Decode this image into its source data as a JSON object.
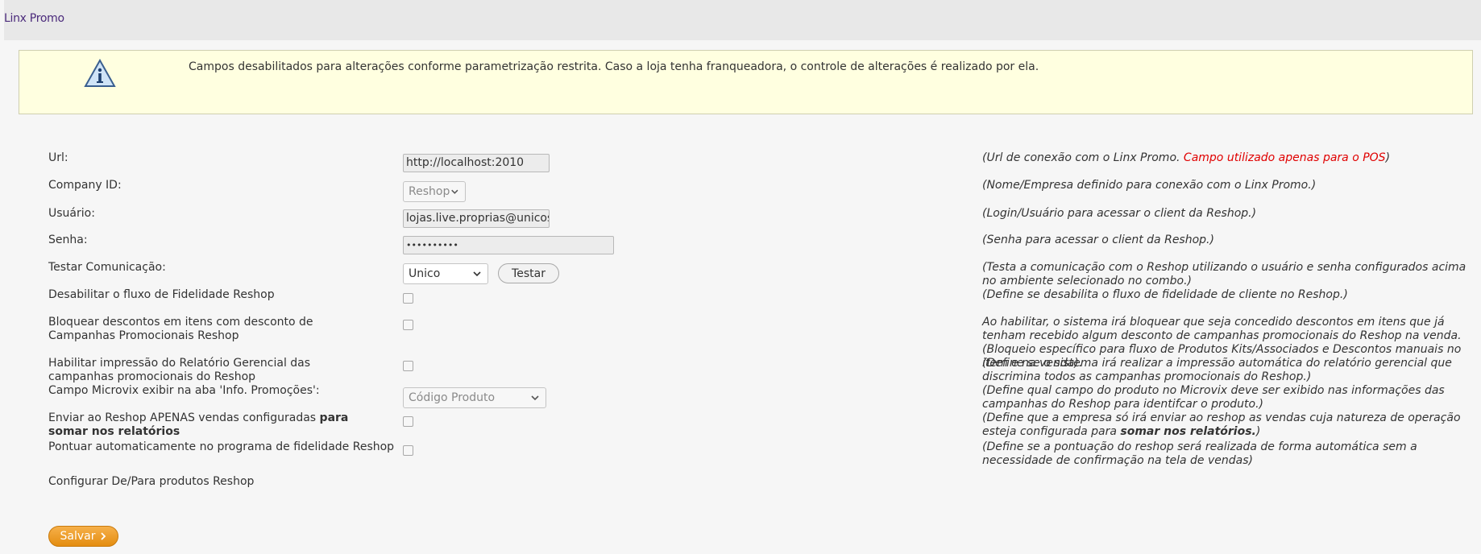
{
  "app": {
    "title": "Linx Promo"
  },
  "alert": {
    "icon": "info-icon",
    "message": "Campos desabilitados para alterações conforme parametrização restrita. Caso a loja tenha franqueadora, o controle de alterações é realizado por ela."
  },
  "form": {
    "url": {
      "label": "Url:",
      "value": "http://localhost:2010",
      "desc": "(Url de conexão com o Linx Promo. ",
      "desc_red": "Campo utilizado apenas para o POS",
      "desc_end": ")"
    },
    "company": {
      "label": "Company ID:",
      "selected": "Reshop",
      "desc": "(Nome/Empresa definido para conexão com o Linx Promo.)"
    },
    "user": {
      "label": "Usuário:",
      "value": "lojas.live.proprias@unicosis",
      "desc": "(Login/Usuário para acessar o client da Reshop.)"
    },
    "password": {
      "label": "Senha:",
      "value": "••••••••••",
      "desc": "(Senha para acessar o client da Reshop.)"
    },
    "test": {
      "label": "Testar Comunicação:",
      "selected": "Unico",
      "button": "Testar",
      "desc": "(Testa a comunicação com o Reshop utilizando o usuário e senha configurados acima no ambiente selecionado no combo.)"
    },
    "fidelity_disable": {
      "label": "Desabilitar o fluxo de Fidelidade Reshop",
      "desc": "(Define se desabilita o fluxo de fidelidade de cliente no Reshop.)"
    },
    "block_discounts": {
      "label": "Bloquear descontos em itens com desconto de Campanhas Promocionais Reshop",
      "desc": "Ao habilitar, o sistema irá bloquear que seja concedido descontos em itens que já tenham recebido algum desconto de campanhas promocionais do Reshop na venda. (Bloqueio específico para fluxo de Produtos Kits/Associados e Descontos manuais no item e na venda)."
    },
    "print_report": {
      "label": "Habilitar impressão do Relatório Gerencial das campanhas promocionais do Reshop",
      "desc": "(Define se o sistema irá realizar a impressão automática do relatório gerencial que discrimina todos as campanhas promocionais do Reshop.)"
    },
    "microvix_field": {
      "label": "Campo Microvix exibir na aba 'Info. Promoções':",
      "selected": "Código Produto",
      "desc": "(Define qual campo do produto no Microvix deve ser exibido nas informações das campanhas do Reshop para identifcar o produto.)"
    },
    "send_sales": {
      "label": "Enviar ao Reshop APENAS vendas configuradas ",
      "label_bold": "para somar nos relatórios",
      "desc": "(Define que a empresa só irá enviar ao reshop as vendas cuja natureza de operação esteja configurada para ",
      "desc_bold": "somar nos relatórios.",
      "desc_end": ")"
    },
    "auto_points": {
      "label": "Pontuar automaticamente no programa de fidelidade Reshop",
      "desc": "(Define se a pontuação do reshop será realizada de forma automática sem a necessidade de confirmação na tela de vendas)"
    },
    "config_link": {
      "label": "Configurar De/Para produtos Reshop"
    },
    "save_button": "Salvar",
    "save_icon": "chevron-right-icon"
  }
}
